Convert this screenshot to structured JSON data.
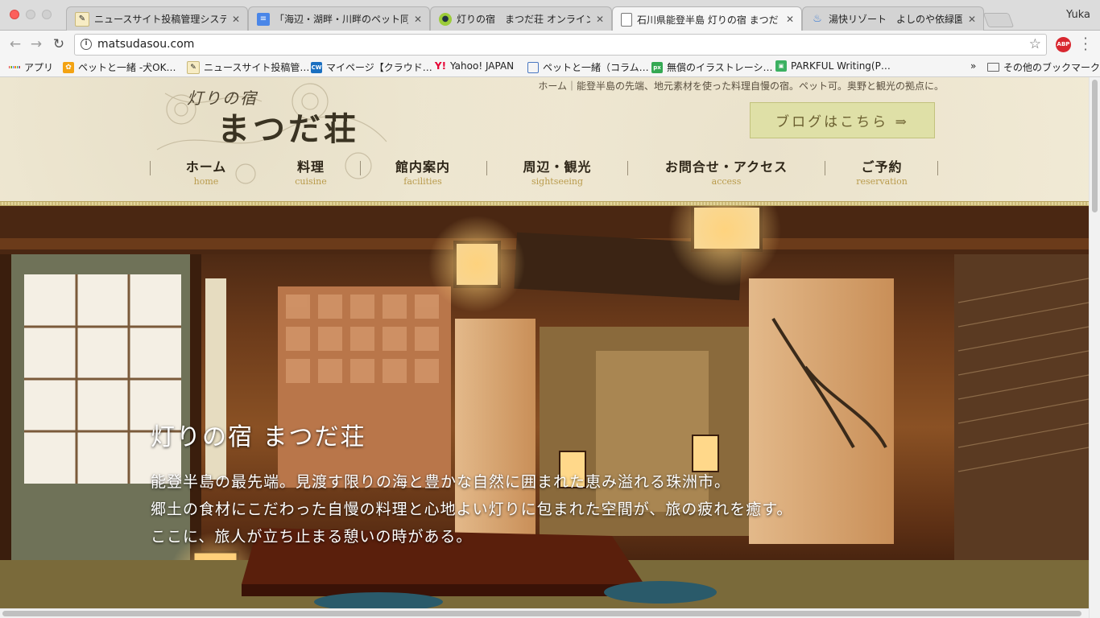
{
  "browser": {
    "user": "Yuka",
    "tabs": [
      {
        "title": "ニュースサイト投稿管理システム",
        "active": false
      },
      {
        "title": "「海辺・湖畔・川畔のペット同伴",
        "active": false
      },
      {
        "title": "灯りの宿　まつだ荘 オンライン予",
        "active": false
      },
      {
        "title": "石川県能登半島 灯りの宿 まつだ",
        "active": true
      },
      {
        "title": "湯快リゾート　よしのや依緑園【",
        "active": false
      }
    ],
    "url": "matsudasou.com",
    "bookmarks": [
      "アプリ",
      "ペットと一緒 -犬OK…",
      "ニュースサイト投稿管…",
      "マイページ【クラウド…",
      "Yahoo! JAPAN",
      "ペットと一緒（コラム…",
      "無償のイラストレーシ…",
      "PARKFUL Writing(P…"
    ],
    "bookmarks_overflow": "»",
    "other_bookmarks": "その他のブックマーク",
    "icons": {
      "back": "back-arrow-icon",
      "forward": "forward-arrow-icon",
      "reload": "reload-icon",
      "star": "star-icon"
    }
  },
  "site": {
    "logo_sub": "灯りの宿",
    "logo_main": "まつだ荘",
    "tagline": "ホーム｜能登半島の先端、地元素材を使った料理自慢の宿。ペット可。奥野と観光の拠点に。",
    "blog_button": "ブログはこちら ⇒",
    "nav": [
      {
        "jp": "ホーム",
        "en": "home"
      },
      {
        "jp": "料理",
        "en": "cuisine"
      },
      {
        "jp": "館内案内",
        "en": "facilities"
      },
      {
        "jp": "周辺・観光",
        "en": "sightseeing"
      },
      {
        "jp": "お問合せ・アクセス",
        "en": "access"
      },
      {
        "jp": "ご予約",
        "en": "reservation"
      }
    ],
    "hero": {
      "title": "灯りの宿 まつだ荘",
      "lines": [
        "能登半島の最先端。見渡す限りの海と豊かな自然に囲まれた恵み溢れる珠洲市。",
        "郷土の食材にこだわった自慢の料理と心地よい灯りに包まれた空間が、旅の疲れを癒す。",
        "ここに、旅人が立ち止まる憩いの時がある。"
      ]
    }
  },
  "colors": {
    "accent": "#b99b4c",
    "header_bg": "#f1ead5",
    "blog_bg": "#dfe0a7"
  }
}
